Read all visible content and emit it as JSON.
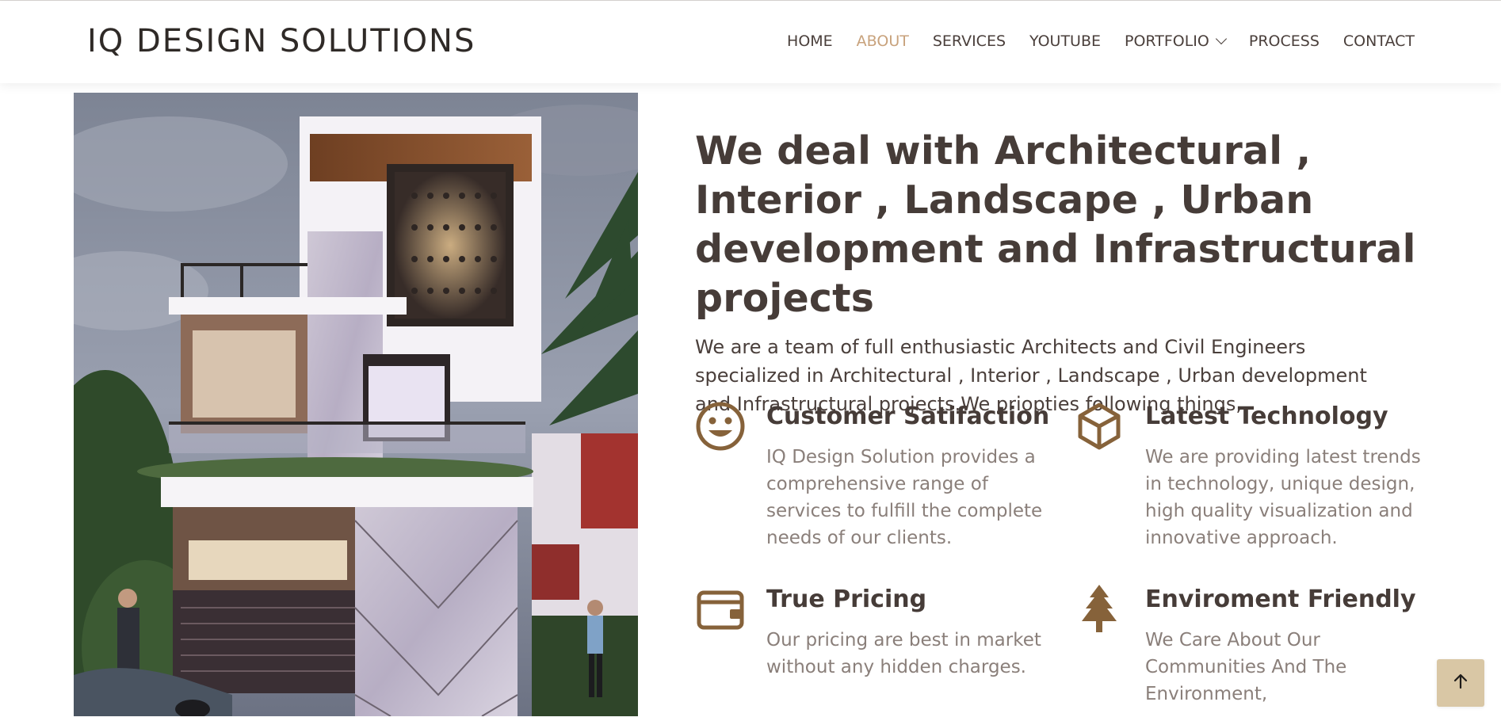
{
  "brand": {
    "logo_text": "IQ DESIGN SOLUTIONS"
  },
  "nav": {
    "items": [
      {
        "label": "HOME"
      },
      {
        "label": "ABOUT"
      },
      {
        "label": "SERVICES"
      },
      {
        "label": "YOUTUBE"
      },
      {
        "label": "PORTFOLIO"
      },
      {
        "label": "PROCESS"
      },
      {
        "label": "CONTACT"
      }
    ],
    "active": "ABOUT"
  },
  "hero": {
    "image_subject": "three-storey modern residential building exterior render"
  },
  "about": {
    "headline": "We deal with Architectural , Interior , Landscape , Urban development and Infrastructural projects",
    "intro": "We are a team of full enthusiastic Architects and Civil Engineers specialized in Architectural , Interior , Landscape , Urban development and Infrastructural projects.We priopties following things,"
  },
  "features": [
    {
      "icon": "smile-icon",
      "title": "Customer Satifaction",
      "description": "IQ Design Solution provides a comprehensive range of services to fulfill the complete needs of our clients."
    },
    {
      "icon": "cube-icon",
      "title": "Latest Technology",
      "description": "We are providing latest trends in technology, unique design, high quality visualization and innovative approach."
    },
    {
      "icon": "wallet-icon",
      "title": "True Pricing",
      "description": "Our pricing are best in market without any hidden charges."
    },
    {
      "icon": "tree-icon",
      "title": "Enviroment Friendly",
      "description": "We Care About Our Communities And The Environment,"
    }
  ],
  "colors": {
    "accent": "#c8a27c",
    "icon_brown": "#86623a",
    "heading": "#463c38",
    "muted_text": "#8a7f7a",
    "back_to_top_bg": "#d9c7a5"
  },
  "back_to_top": {
    "icon": "arrow-up-icon"
  }
}
